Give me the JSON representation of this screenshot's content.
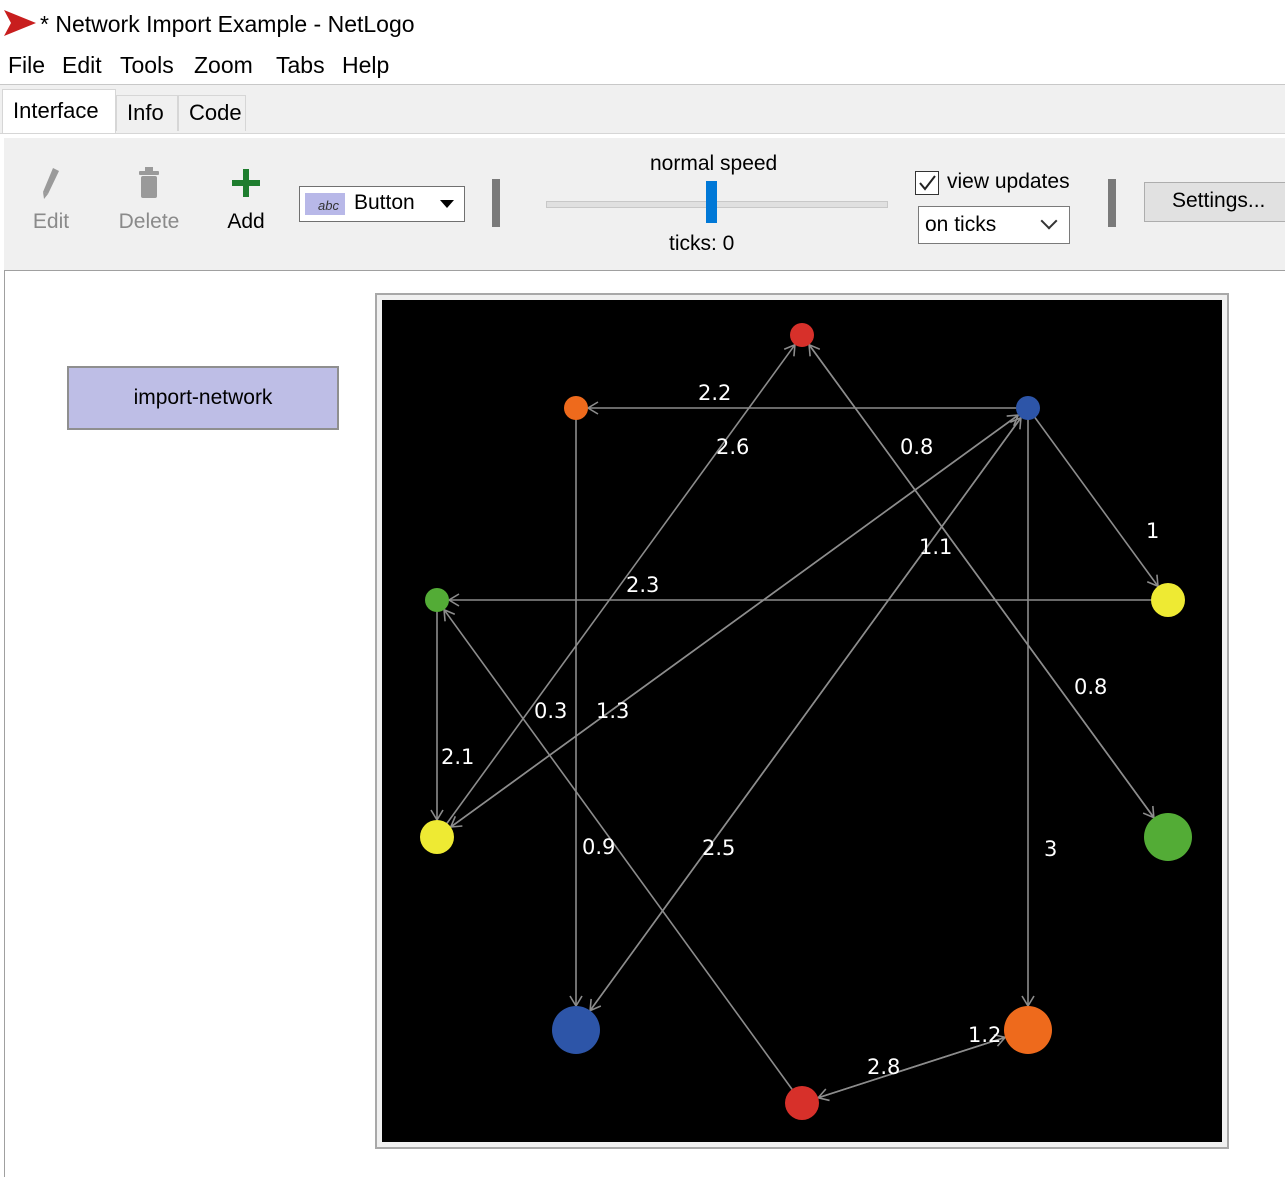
{
  "window": {
    "title": "* Network Import Example - NetLogo"
  },
  "menu": [
    "File",
    "Edit",
    "Tools",
    "Zoom",
    "Tabs",
    "Help"
  ],
  "tabs": [
    {
      "label": "Interface",
      "active": true
    },
    {
      "label": "Info",
      "active": false
    },
    {
      "label": "Code",
      "active": false
    }
  ],
  "toolbar": {
    "edit_label": "Edit",
    "delete_label": "Delete",
    "add_label": "Add",
    "widget_type": "Button",
    "widget_badge": "abc",
    "speed_label": "normal speed",
    "speed_value": 0.5,
    "ticks_label": "ticks: 0",
    "view_updates_label": "view updates",
    "view_updates_checked": true,
    "update_mode": "on ticks",
    "settings_label": "Settings..."
  },
  "widgets": {
    "import_button_label": "import-network"
  },
  "network": {
    "background": "#000000",
    "link_color": "#8c8c8c",
    "nodes": [
      {
        "id": "n1",
        "color": "#d7302a",
        "size": "small"
      },
      {
        "id": "n2",
        "color": "#ee6a1c",
        "size": "small"
      },
      {
        "id": "n3",
        "color": "#2d55a8",
        "size": "small"
      },
      {
        "id": "n4",
        "color": "#53ac36",
        "size": "small"
      },
      {
        "id": "n5",
        "color": "#eeea33",
        "size": "medium"
      },
      {
        "id": "n6",
        "color": "#eeea33",
        "size": "medium"
      },
      {
        "id": "n7",
        "color": "#53ac36",
        "size": "large"
      },
      {
        "id": "n8",
        "color": "#2d55a8",
        "size": "large"
      },
      {
        "id": "n9",
        "color": "#ee6a1c",
        "size": "large"
      },
      {
        "id": "n10",
        "color": "#d7302a",
        "size": "medium"
      }
    ],
    "links": [
      {
        "from": "n3",
        "to": "n2",
        "label": "2.2"
      },
      {
        "from": "n6",
        "to": "n1",
        "label": "2.6"
      },
      {
        "from": "n7",
        "to": "n1",
        "label": "0.8"
      },
      {
        "from": "n1",
        "to": "n7",
        "label": "0.8"
      },
      {
        "from": "n3",
        "to": "n5",
        "label": "1"
      },
      {
        "from": "n8",
        "to": "n3",
        "label": "1.1"
      },
      {
        "from": "n5",
        "to": "n4",
        "label": "2.3"
      },
      {
        "from": "n6",
        "to": "n3",
        "label": "0.3"
      },
      {
        "from": "n3",
        "to": "n6",
        "label": "1.3"
      },
      {
        "from": "n4",
        "to": "n6",
        "label": "2.1"
      },
      {
        "from": "n2",
        "to": "n8",
        "label": "0.9"
      },
      {
        "from": "n3",
        "to": "n8",
        "label": "2.5"
      },
      {
        "from": "n3",
        "to": "n9",
        "label": "3"
      },
      {
        "from": "n10",
        "to": "n4",
        "label": ""
      },
      {
        "from": "n10",
        "to": "n9",
        "label": "1.2"
      },
      {
        "from": "n9",
        "to": "n10",
        "label": "2.8"
      }
    ]
  }
}
